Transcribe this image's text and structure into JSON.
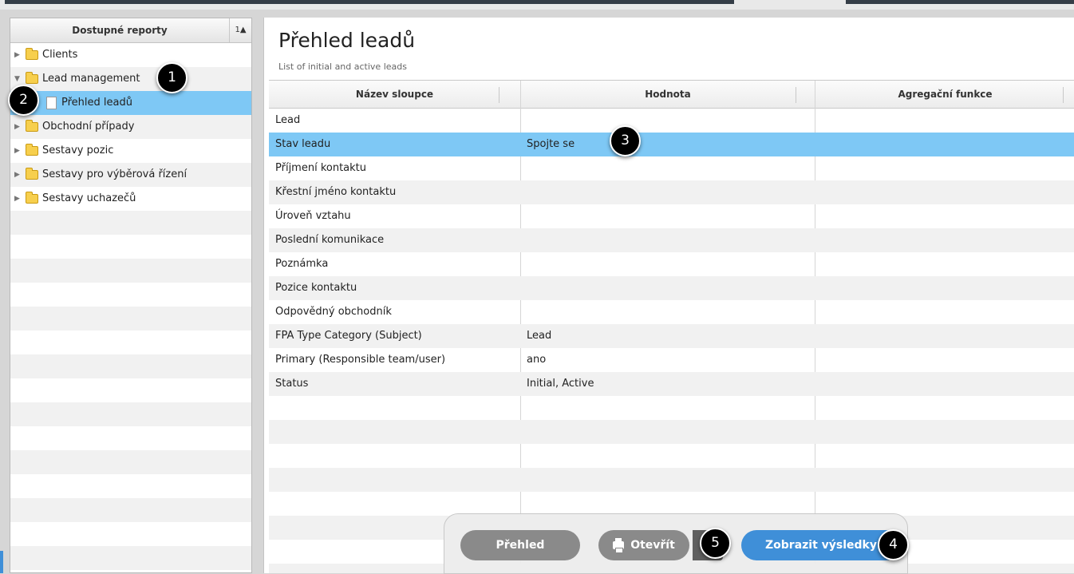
{
  "sidebar": {
    "title": "Dostupné reporty",
    "sort_label": "1▲",
    "items": [
      {
        "label": "Clients",
        "expanded": false
      },
      {
        "label": "Lead management",
        "expanded": true
      },
      {
        "label": "Přehled leadů",
        "selected": true
      },
      {
        "label": "Obchodní případy",
        "expanded": false
      },
      {
        "label": "Sestavy pozic",
        "expanded": false
      },
      {
        "label": "Sestavy pro výběrová řízení",
        "expanded": false
      },
      {
        "label": "Sestavy uchazečů",
        "expanded": false
      }
    ]
  },
  "main": {
    "title": "Přehled leadů",
    "subtitle": "List of initial and active leads",
    "columns": [
      "Název sloupce",
      "Hodnota",
      "Agregační funkce"
    ],
    "rows": [
      {
        "name": "Lead",
        "value": ""
      },
      {
        "name": "Stav leadu",
        "value": "Spojte se",
        "selected": true
      },
      {
        "name": "Příjmení kontaktu",
        "value": ""
      },
      {
        "name": "Křestní jméno kontaktu",
        "value": ""
      },
      {
        "name": "Úroveň vztahu",
        "value": ""
      },
      {
        "name": "Poslední komunikace",
        "value": ""
      },
      {
        "name": "Poznámka",
        "value": ""
      },
      {
        "name": "Pozice kontaktu",
        "value": ""
      },
      {
        "name": "Odpovědný obchodník",
        "value": ""
      },
      {
        "name": "FPA Type Category (Subject)",
        "value": "Lead"
      },
      {
        "name": "Primary (Responsible team/user)",
        "value": "ano"
      },
      {
        "name": "Status",
        "value": "Initial, Active"
      }
    ]
  },
  "toolbar": {
    "prehled_label": "Přehled",
    "otevrit_label": "Otevřít",
    "zobrazit_label": "Zobrazit výsledky"
  },
  "callouts": [
    "1",
    "2",
    "3",
    "4",
    "5"
  ],
  "colors": {
    "selection": "#7ec8f5",
    "primary_button": "#3f8fd8",
    "secondary_button": "#8a8a8a"
  }
}
